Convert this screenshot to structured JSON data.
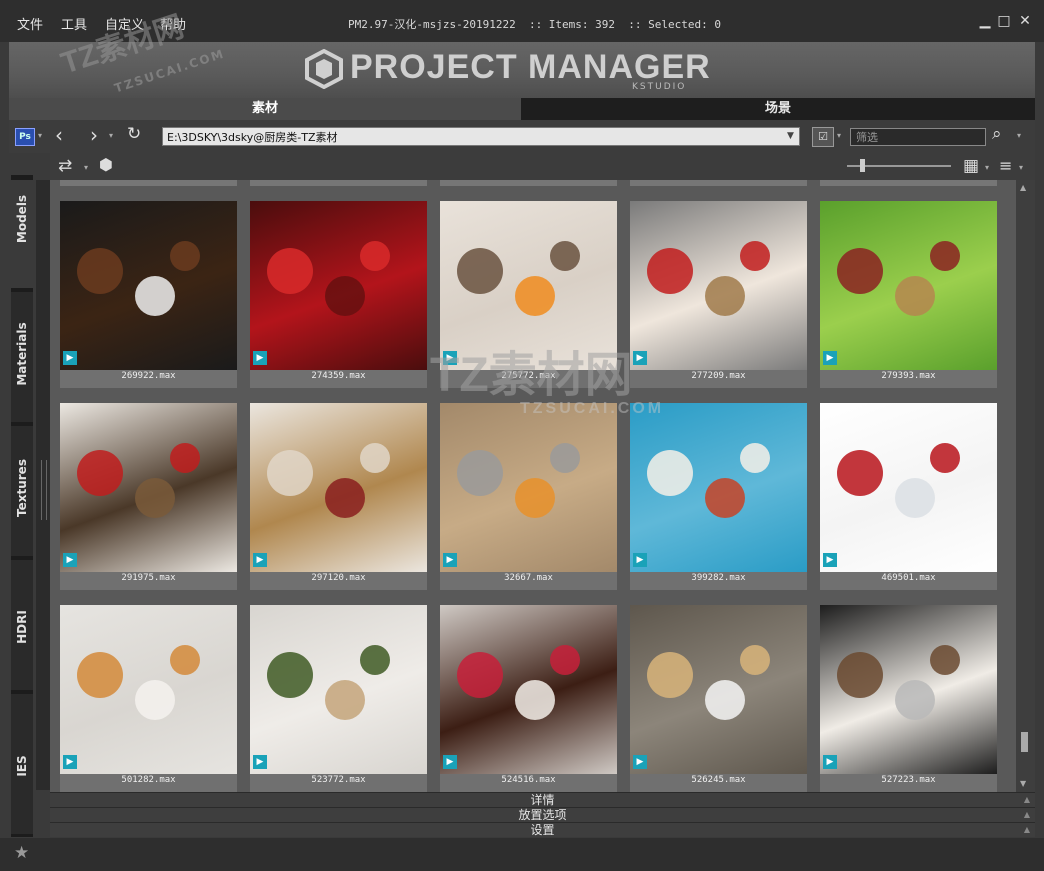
{
  "menu": [
    "文件",
    "工具",
    "自定义",
    "帮助"
  ],
  "window_title": "PM2.97-汉化-msjzs-20191222  :: Items: 392  :: Selected: 0",
  "logo": {
    "title": "PROJECT MANAGER",
    "subtitle": "KSTUDIO"
  },
  "tabs": [
    {
      "label": "素材",
      "active": true
    },
    {
      "label": "场景",
      "active": false
    }
  ],
  "toolbar": {
    "path": "E:\\3DSKY\\3dsky@厨房类-TZ素材",
    "filter_placeholder": "筛选"
  },
  "side_tabs": [
    "Models",
    "Materials",
    "Textures",
    "HDRI",
    "IES"
  ],
  "watermark": {
    "main": "TZ素材网",
    "sub": "TZSUCAI.COM"
  },
  "items": [
    {
      "label": "269922.max",
      "subject": "coffee-glasses"
    },
    {
      "label": "274359.max",
      "subject": "red-apples-top"
    },
    {
      "label": "275772.max",
      "subject": "fruit-table"
    },
    {
      "label": "277209.max",
      "subject": "apple-baskets-strip"
    },
    {
      "label": "279393.max",
      "subject": "apple-basket"
    },
    {
      "label": "291975.max",
      "subject": "kitchen-board"
    },
    {
      "label": "297120.max",
      "subject": "mushroom-basket"
    },
    {
      "label": "32667.max",
      "subject": "coffee-pot"
    },
    {
      "label": "399282.max",
      "subject": "breakfast-blue"
    },
    {
      "label": "469501.max",
      "subject": "apple-bowl"
    },
    {
      "label": "501282.max",
      "subject": "donuts-coffee"
    },
    {
      "label": "523772.max",
      "subject": "avocado-knife"
    },
    {
      "label": "524516.max",
      "subject": "berry-cake"
    },
    {
      "label": "526245.max",
      "subject": "bread-milk"
    },
    {
      "label": "527223.max",
      "subject": "sweets-set"
    }
  ],
  "bottom_panels": [
    "详情",
    "放置选项",
    "设置"
  ],
  "colors": {
    "accent_badge": "#1aa2b8",
    "active_tab": "#4b4b4b",
    "inactive_tab": "#1e1e1e"
  }
}
